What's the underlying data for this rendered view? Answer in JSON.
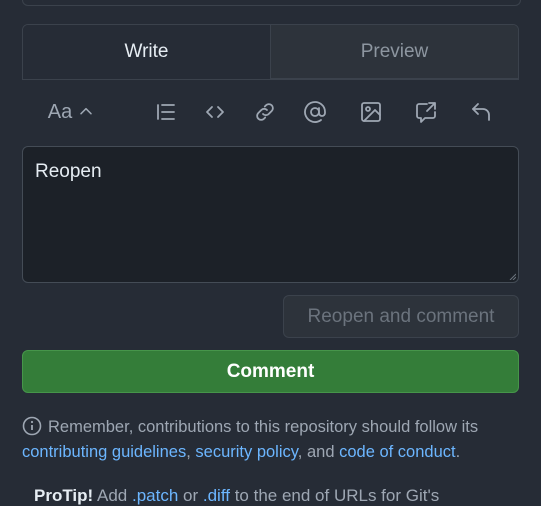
{
  "tabs": {
    "write": "Write",
    "preview": "Preview"
  },
  "toolbar": {
    "text_style": "Aa",
    "icons": [
      "chevron-up-icon",
      "list-icon",
      "code-icon",
      "link-icon",
      "mention-icon",
      "image-icon",
      "reference-icon",
      "reply-icon"
    ]
  },
  "editor": {
    "value": "Reopen"
  },
  "buttons": {
    "reopen": "Reopen and comment",
    "comment": "Comment"
  },
  "note": {
    "prefix": "Remember, contributions to this repository should follow its",
    "link1": "contributing guidelines",
    "sep1": ",",
    "link2": "security policy",
    "sep2": ", and",
    "link3": "code of conduct",
    "suffix": "."
  },
  "protip": {
    "label": "ProTip!",
    "text1": "Add",
    "link1": ".patch",
    "text2": "or",
    "link2": ".diff",
    "text3": "to the end of URLs for Git's"
  },
  "colors": {
    "accent_green": "#347d39",
    "link_blue": "#6cb6ff",
    "background": "#262c36"
  }
}
